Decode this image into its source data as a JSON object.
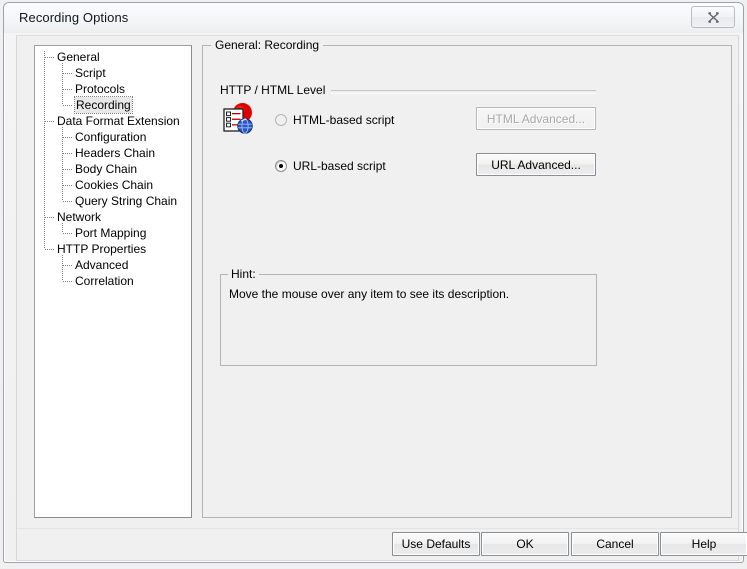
{
  "window": {
    "title": "Recording Options",
    "close_label": "✕"
  },
  "tree": {
    "items": [
      {
        "label": "General",
        "level": 1,
        "selected": false
      },
      {
        "label": "Script",
        "level": 2,
        "selected": false
      },
      {
        "label": "Protocols",
        "level": 2,
        "selected": false
      },
      {
        "label": "Recording",
        "level": 2,
        "selected": true
      },
      {
        "label": "Data Format Extension",
        "level": 1,
        "selected": false
      },
      {
        "label": "Configuration",
        "level": 2,
        "selected": false
      },
      {
        "label": "Headers Chain",
        "level": 2,
        "selected": false
      },
      {
        "label": "Body Chain",
        "level": 2,
        "selected": false
      },
      {
        "label": "Cookies Chain",
        "level": 2,
        "selected": false
      },
      {
        "label": "Query String Chain",
        "level": 2,
        "selected": false
      },
      {
        "label": "Network",
        "level": 1,
        "selected": false
      },
      {
        "label": "Port Mapping",
        "level": 2,
        "selected": false
      },
      {
        "label": "HTTP Properties",
        "level": 1,
        "selected": false
      },
      {
        "label": "Advanced",
        "level": 2,
        "selected": false
      },
      {
        "label": "Correlation",
        "level": 2,
        "selected": false
      }
    ]
  },
  "content": {
    "legend": "General: Recording",
    "group_label": "HTTP / HTML Level",
    "icon_name": "html-protocol-icon",
    "options": [
      {
        "label": "HTML-based script",
        "selected": false,
        "enabled": true,
        "button_label": "HTML Advanced...",
        "button_enabled": false
      },
      {
        "label": "URL-based script",
        "selected": true,
        "enabled": true,
        "button_label": "URL Advanced...",
        "button_enabled": true
      }
    ],
    "hint": {
      "legend": "Hint:",
      "text": "Move the mouse over any item to see its description."
    }
  },
  "footer": {
    "buttons": [
      {
        "label": "Use Defaults",
        "enabled": true
      },
      {
        "label": "OK",
        "enabled": true
      },
      {
        "label": "Cancel",
        "enabled": true
      },
      {
        "label": "Help",
        "enabled": true
      }
    ]
  },
  "colors": {
    "dialog_bg": "#f0f0f0",
    "tree_bg": "#ffffff",
    "icon_red": "#e00000",
    "icon_blue": "#2a56c6",
    "text": "#000000",
    "disabled_text": "#a8a8a8"
  }
}
